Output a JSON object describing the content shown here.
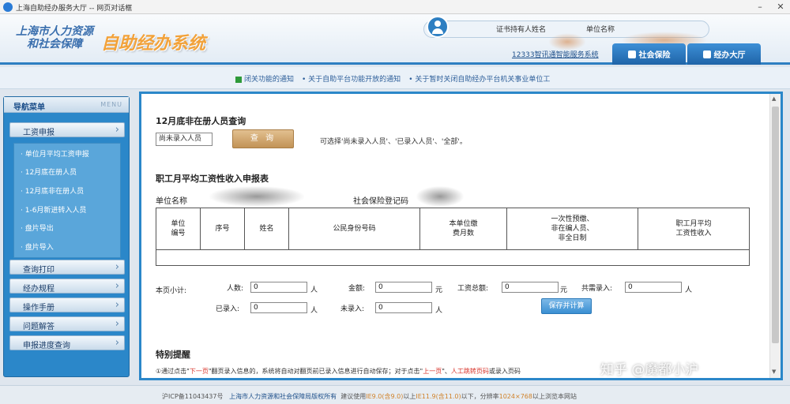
{
  "window": {
    "title": "上海自助经办服务大厅 -- 网页对话框"
  },
  "header": {
    "logo_line1": "上海市人力资源",
    "logo_line2": "和社会保障",
    "system_name": "自助经办系统",
    "cert_holder_label": "证书持有人姓名",
    "unit_name_label": "单位名称",
    "service_link": "12333智讯通智能服务系统",
    "nav_tabs": [
      {
        "label": "社会保险"
      },
      {
        "label": "经办大厅"
      }
    ]
  },
  "notices": [
    "闭关功能的通知",
    "• 关于自助平台功能开放的通知",
    "• 关于暂时关闭自助经办平台机关事业单位工"
  ],
  "sidebar": {
    "title": "导航菜单",
    "menu_tag": "MENU",
    "sections": [
      {
        "label": "工资申报"
      },
      {
        "label": "查询打印"
      },
      {
        "label": "经办规程"
      },
      {
        "label": "操作手册"
      },
      {
        "label": "问题解答"
      },
      {
        "label": "申报进度查询"
      }
    ],
    "sub_items": [
      "· 单位月平均工资申报",
      "· 12月底在册人员",
      "· 12月底非在册人员",
      "· 1-6月新进转入人员",
      "· 盘片导出",
      "· 盘片导入"
    ]
  },
  "query": {
    "title": "12月底非在册人员查询",
    "select_value": "尚未录入人员",
    "button": "查 询",
    "hint": "可选择'尚未录入人员'、'已录入人员'、'全部'。"
  },
  "form": {
    "title": "职工月平均工资性收入申报表",
    "unit_name_label": "单位名称",
    "social_reg_label": "社会保险登记码",
    "columns": [
      "单位\n编号",
      "序号",
      "姓名",
      "公民身份号码",
      "本单位缴\n费月数",
      "一次性预缴、\n非在编人员、\n非全日制",
      "职工月平均\n工资性收入"
    ]
  },
  "summary": {
    "page_subtotal": "本页小计:",
    "persons_label": "人数:",
    "persons_value": "0",
    "persons_unit": "人",
    "amount_label": "金额:",
    "amount_value": "0",
    "amount_unit": "元",
    "wage_total_label": "工资总额:",
    "wage_total_value": "0",
    "wage_total_unit": "元",
    "need_entry_label": "共需录入:",
    "need_entry_value": "0",
    "need_entry_unit": "人",
    "entered_label": "已录入:",
    "entered_value": "0",
    "entered_unit": "人",
    "not_entered_label": "未录入:",
    "not_entered_value": "0",
    "not_entered_unit": "人",
    "save_button": "保存并计算"
  },
  "reminder": {
    "title": "特别提醒",
    "text_a": "①通过点击\"",
    "text_b": "下一页",
    "text_c": "\"翻页录入信息的，系统将自动对翻页前已录入信息进行自动保存；对于点击\"",
    "text_d": "上一页",
    "text_e": "\"、",
    "text_f": "人工跳转页码",
    "text_g": "或录入页码"
  },
  "watermark": "知乎 @魔都小沪",
  "footer": {
    "icp": "沪ICP备11043437号",
    "owner": "上海市人力资源和社会保障局版权所有",
    "browser_a": "建议使用",
    "ie_a": "IE9.0(含9.0)",
    "browser_b": "以上",
    "ie_b": "IE11.9(含11.0)",
    "browser_c": "以下，分辨率",
    "res": "1024×768",
    "browser_d": "以上浏览本网站"
  },
  "colors": {
    "accent": "#2b87c9",
    "brand_orange": "#f2a23a",
    "button_tan": "#c29356",
    "alert_red": "#d8332a"
  }
}
